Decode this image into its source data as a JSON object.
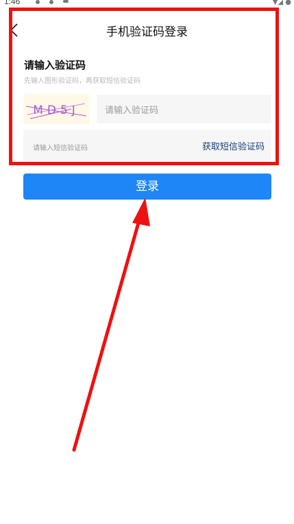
{
  "status_bar": {
    "time": "1:46"
  },
  "nav": {
    "title": "手机验证码登录"
  },
  "form": {
    "section_title": "请输入验证码",
    "section_hint": "先输入图形验证码，再获取短信验证码",
    "captcha_text": "MD5J",
    "captcha_placeholder": "请输入验证码",
    "sms_placeholder": "请输入短信验证码",
    "get_sms_label": "获取短信验证码",
    "login_label": "登录"
  },
  "icons": {
    "back": "chevron-left-icon"
  },
  "colors": {
    "primary_button": "#1f86f7",
    "link_text": "#1a3f7a",
    "annotation": "#ee1111",
    "captcha_glyphs": "#a65bd6"
  }
}
